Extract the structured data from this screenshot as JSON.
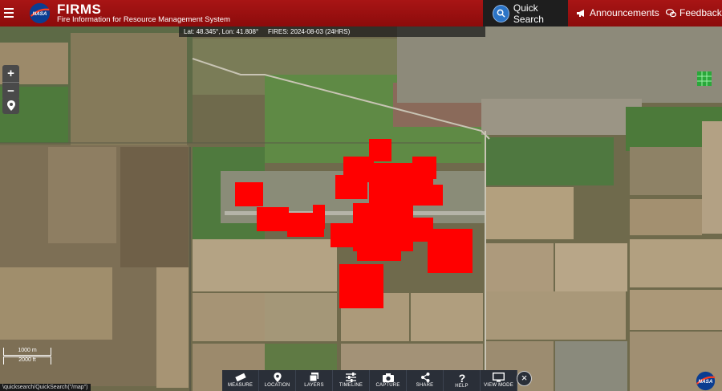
{
  "header": {
    "title": "FIRMS",
    "subtitle": "Fire Information for Resource Management System",
    "quick_search": "Quick Search",
    "announcements": "Announcements",
    "feedback": "Feedback"
  },
  "info_bar": {
    "coords": "Lat: 48.345°, Lon: 41.808°",
    "fires": "FIRES: 2024-08-03 (24HRS)"
  },
  "scale": {
    "metric": "1000 m",
    "imperial": "2000 ft"
  },
  "status_url": "\\quicksearch/QuickSearch(\"/map\")",
  "toolbar": [
    {
      "label": "MEASURE",
      "icon": "ruler-icon"
    },
    {
      "label": "LOCATION",
      "icon": "pin-icon"
    },
    {
      "label": "LAYERS",
      "icon": "layers-icon"
    },
    {
      "label": "TIMELINE",
      "icon": "sliders-icon"
    },
    {
      "label": "CAPTURE",
      "icon": "camera-icon"
    },
    {
      "label": "SHARE",
      "icon": "share-icon"
    },
    {
      "label": "HELP",
      "icon": "help-icon"
    },
    {
      "label": "VIEW MODE",
      "icon": "monitor-icon"
    }
  ],
  "colors": {
    "header": "#8c0b0b",
    "fire": "#ff0000",
    "accent": "#2b74c6"
  }
}
